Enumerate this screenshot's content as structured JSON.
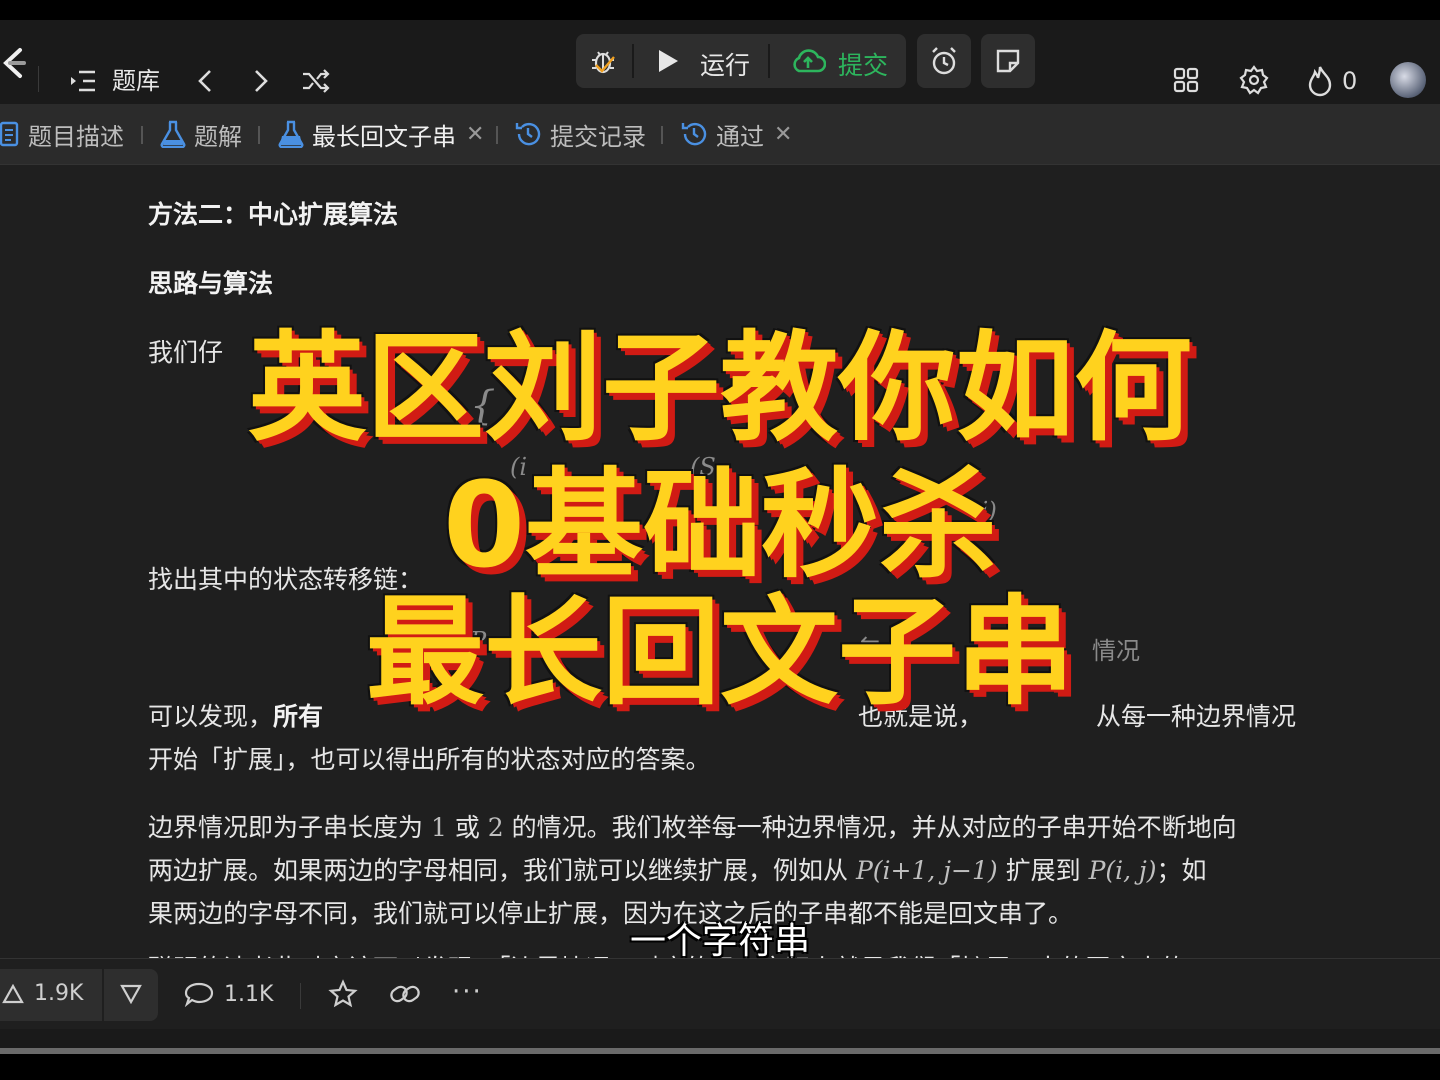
{
  "topbar": {
    "problem_bank": "题库",
    "run_label": "运行",
    "submit_label": "提交",
    "streak_count": "0",
    "colors": {
      "submit": "#2db55d",
      "accent": "#ffd21e"
    }
  },
  "tabs": [
    {
      "label": "题目描述",
      "icon": "description-icon"
    },
    {
      "label": "题解",
      "icon": "flask-icon"
    },
    {
      "label": "最长回文子串",
      "icon": "flask-icon",
      "closable": true,
      "active": true
    },
    {
      "label": "提交记录",
      "icon": "history-icon"
    },
    {
      "label": "通过",
      "icon": "history-icon",
      "closable": true
    }
  ],
  "content": {
    "heading": "方法二：中心扩展算法",
    "subheading": "思路与算法",
    "p1_partial": "我们仔",
    "p2": "找出其中的状态转移链：",
    "p3_line1_a": "可以发现，",
    "p3_line1_b": "所有",
    "p3_line1_c": "也就是说，",
    "p3_line1_d": "从每一种边界情况",
    "p3_line2": "开始「扩展」，也可以得出所有的状态对应的答案。",
    "chain_right": "情况",
    "p4_l1_a": "边界情况即为子串长度为",
    "p4_l1_one": "1",
    "p4_l1_or": "或",
    "p4_l1_two": "2",
    "p4_l1_b": "的情况。我们枚举每一种边界情况，并从对应的子串开始不断地向",
    "p4_l2_a": "两边扩展。如果两边的字母相同，我们就可以继续扩展，例如从",
    "p4_l2_m1": "P(i+1, j−1)",
    "p4_l2_b": "扩展到",
    "p4_l2_m2": "P(i, j)",
    "p4_l2_c": "；如",
    "p4_l3": "果两边的字母不同，我们就可以停止扩展，因为在这之后的子串都不能是回文串了。",
    "p5_partial": "聪明的读者此时应该可以发现，「边界情况」对应的子串实际上就是我们「扩展」出的回文串的"
  },
  "actions": {
    "upvotes": "1.9K",
    "comments": "1.1K"
  },
  "overlay": {
    "line1": "英区刘子教你如何",
    "line2": "0基础秒杀",
    "line3": "最长回文子串",
    "subtitle": "一个字符串"
  }
}
